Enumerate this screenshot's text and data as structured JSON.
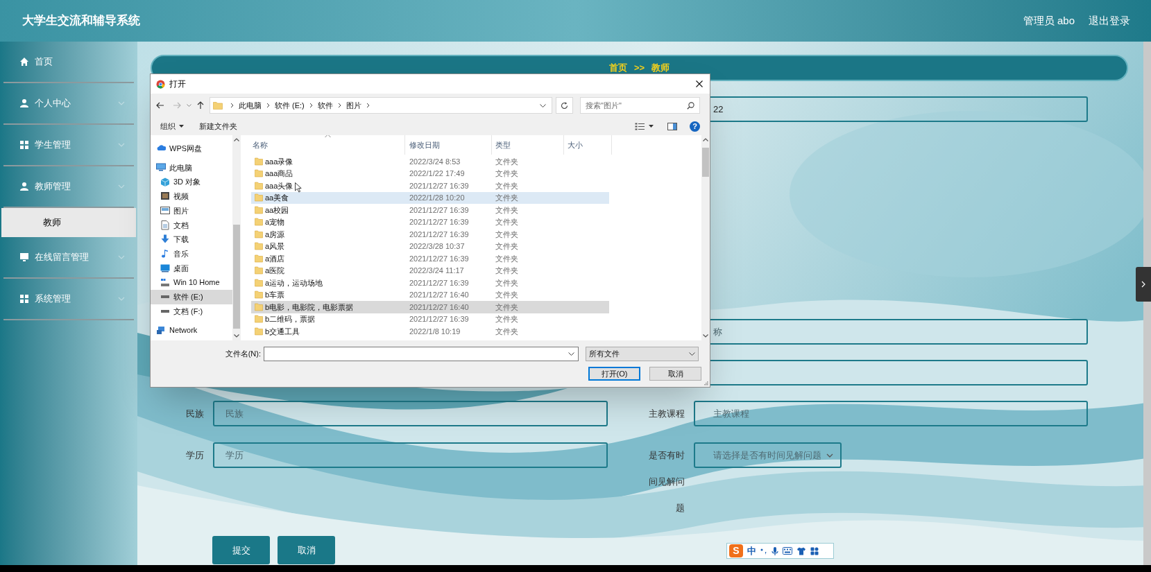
{
  "header": {
    "title": "大学生交流和辅导系统",
    "user": "管理员 abo",
    "logout": "退出登录"
  },
  "sidebar": {
    "items": [
      {
        "label": "首页",
        "kind": "link"
      },
      {
        "label": "个人中心",
        "kind": "group"
      },
      {
        "label": "学生管理",
        "kind": "group"
      },
      {
        "label": "教师管理",
        "kind": "group",
        "children": [
          {
            "label": "教师",
            "selected": true
          }
        ]
      },
      {
        "label": "在线留言管理",
        "kind": "group"
      },
      {
        "label": "系统管理",
        "kind": "group"
      }
    ]
  },
  "breadcrumb": {
    "items": [
      "首页",
      "教师"
    ],
    "separator": ">>"
  },
  "form": {
    "rows": [
      {
        "right": {
          "kind": "input",
          "value": "22"
        }
      },
      {
        "right": {
          "kind": "input",
          "placeholder": "称"
        }
      },
      {
        "right": {
          "kind": "input"
        }
      },
      {
        "left": {
          "kind": "input",
          "label": "民族",
          "placeholder": "民族"
        },
        "right": {
          "kind": "input",
          "label": "主教课程",
          "placeholder": "主教课程"
        }
      },
      {
        "left": {
          "kind": "input",
          "label": "学历",
          "placeholder": "学历"
        },
        "right": {
          "kind": "select",
          "label": "是否有时间见解问题",
          "placeholder": "请选择是否有时间见解问题"
        }
      }
    ],
    "buttons": [
      "提交",
      "取消"
    ]
  },
  "dialog": {
    "title": "打开",
    "path": [
      "此电脑",
      "软件 (E:)",
      "软件",
      "图片"
    ],
    "search_placeholder": "搜索\"图片\"",
    "toolbar": [
      "组织",
      "新建文件夹"
    ],
    "help": "?",
    "nav": [
      {
        "label": "WPS网盘",
        "selected": false
      },
      {
        "label": "此电脑",
        "selected": false,
        "children": [
          {
            "label": "3D 对象",
            "selected": false
          },
          {
            "label": "视频",
            "selected": false
          },
          {
            "label": "图片",
            "selected": false
          },
          {
            "label": "文档",
            "selected": false
          },
          {
            "label": "下载",
            "selected": false
          },
          {
            "label": "音乐",
            "selected": false
          },
          {
            "label": "桌面",
            "selected": false
          },
          {
            "label": "Win 10 Home",
            "selected": false
          },
          {
            "label": "软件 (E:)",
            "selected": true
          },
          {
            "label": "文档 (F:)",
            "selected": false
          }
        ]
      },
      {
        "label": "Network",
        "selected": false
      }
    ],
    "columns": [
      "名称",
      "修改日期",
      "类型",
      "大小"
    ],
    "rows": [
      {
        "name": "aaa录像",
        "date": "2022/3/24 8:53",
        "type": "文件夹",
        "selected": false,
        "hovered": false
      },
      {
        "name": "aaa商品",
        "date": "2022/1/22 17:49",
        "type": "文件夹",
        "selected": false,
        "hovered": false
      },
      {
        "name": "aaa头像",
        "date": "2021/12/27 16:39",
        "type": "文件夹",
        "selected": false,
        "hovered": false
      },
      {
        "name": "aa美食",
        "date": "2022/1/28 10:20",
        "type": "文件夹",
        "selected": false,
        "hovered": true
      },
      {
        "name": "aa校园",
        "date": "2021/12/27 16:39",
        "type": "文件夹",
        "selected": false,
        "hovered": false
      },
      {
        "name": "a宠物",
        "date": "2021/12/27 16:39",
        "type": "文件夹",
        "selected": false,
        "hovered": false
      },
      {
        "name": "a房源",
        "date": "2021/12/27 16:39",
        "type": "文件夹",
        "selected": false,
        "hovered": false
      },
      {
        "name": "a风景",
        "date": "2022/3/28 10:37",
        "type": "文件夹",
        "selected": false,
        "hovered": false
      },
      {
        "name": "a酒店",
        "date": "2021/12/27 16:39",
        "type": "文件夹",
        "selected": false,
        "hovered": false
      },
      {
        "name": "a医院",
        "date": "2022/3/24 11:17",
        "type": "文件夹",
        "selected": false,
        "hovered": false
      },
      {
        "name": "a运动，运动场地",
        "date": "2021/12/27 16:39",
        "type": "文件夹",
        "selected": false,
        "hovered": false
      },
      {
        "name": "b车票",
        "date": "2021/12/27 16:40",
        "type": "文件夹",
        "selected": false,
        "hovered": false
      },
      {
        "name": "b电影，电影院，电影票据",
        "date": "2021/12/27 16:40",
        "type": "文件夹",
        "selected": true,
        "hovered": false
      },
      {
        "name": "b二维码，票据",
        "date": "2021/12/27 16:39",
        "type": "文件夹",
        "selected": false,
        "hovered": false
      },
      {
        "name": "b交通工具",
        "date": "2022/1/8 10:19",
        "type": "文件夹",
        "selected": false,
        "hovered": false
      }
    ],
    "filename_label": "文件名(N):",
    "filter": "所有文件",
    "buttons": [
      {
        "label": "打开(O)",
        "default": true
      },
      {
        "label": "取消",
        "default": false
      }
    ]
  },
  "ime_bar": {
    "logo": "S",
    "mode": "中"
  }
}
